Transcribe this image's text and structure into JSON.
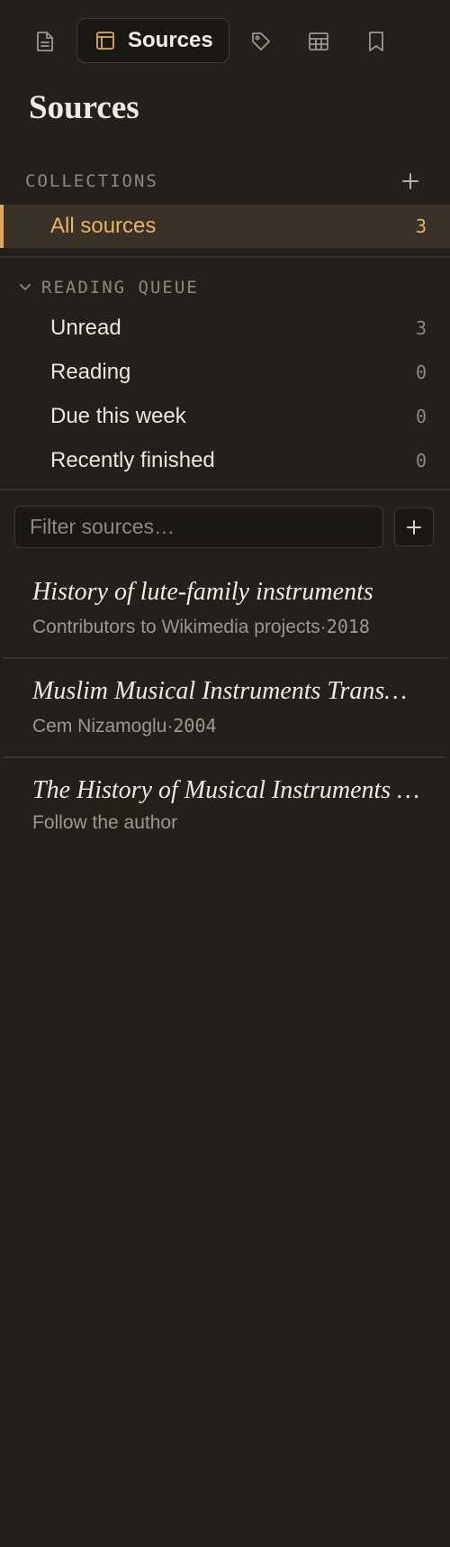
{
  "tabs": {
    "active_label": "Sources",
    "icons": [
      "document-icon",
      "sources-icon",
      "tag-icon",
      "table-icon",
      "bookmark-icon"
    ]
  },
  "page": {
    "title": "Sources"
  },
  "collections": {
    "heading": "COLLECTIONS",
    "add_icon": "plus-icon",
    "all_sources": {
      "label": "All sources",
      "count": "3"
    }
  },
  "reading_queue": {
    "heading": "READING QUEUE",
    "toggle_icon": "chevron-down-icon",
    "items": [
      {
        "label": "Unread",
        "count": "3"
      },
      {
        "label": "Reading",
        "count": "0"
      },
      {
        "label": "Due this week",
        "count": "0"
      },
      {
        "label": "Recently finished",
        "count": "0"
      }
    ]
  },
  "filter": {
    "placeholder": "Filter sources…",
    "value": "",
    "add_icon": "plus-icon"
  },
  "sources": [
    {
      "title": "History of lute-family instruments",
      "author": "Contributors to Wikimedia projects",
      "separator": "·",
      "year": "2018"
    },
    {
      "title": "Muslim Musical Instruments Trans…",
      "author": "Cem Nizamoglu",
      "separator": "·",
      "year": "2004"
    },
    {
      "title": "The History of Musical Instruments …",
      "author": "Follow the author",
      "separator": "",
      "year": ""
    }
  ],
  "colors": {
    "background": "#23201c",
    "accent": "#e3a95a",
    "selected_row": "#3a3127",
    "muted_text": "#8f887d"
  }
}
